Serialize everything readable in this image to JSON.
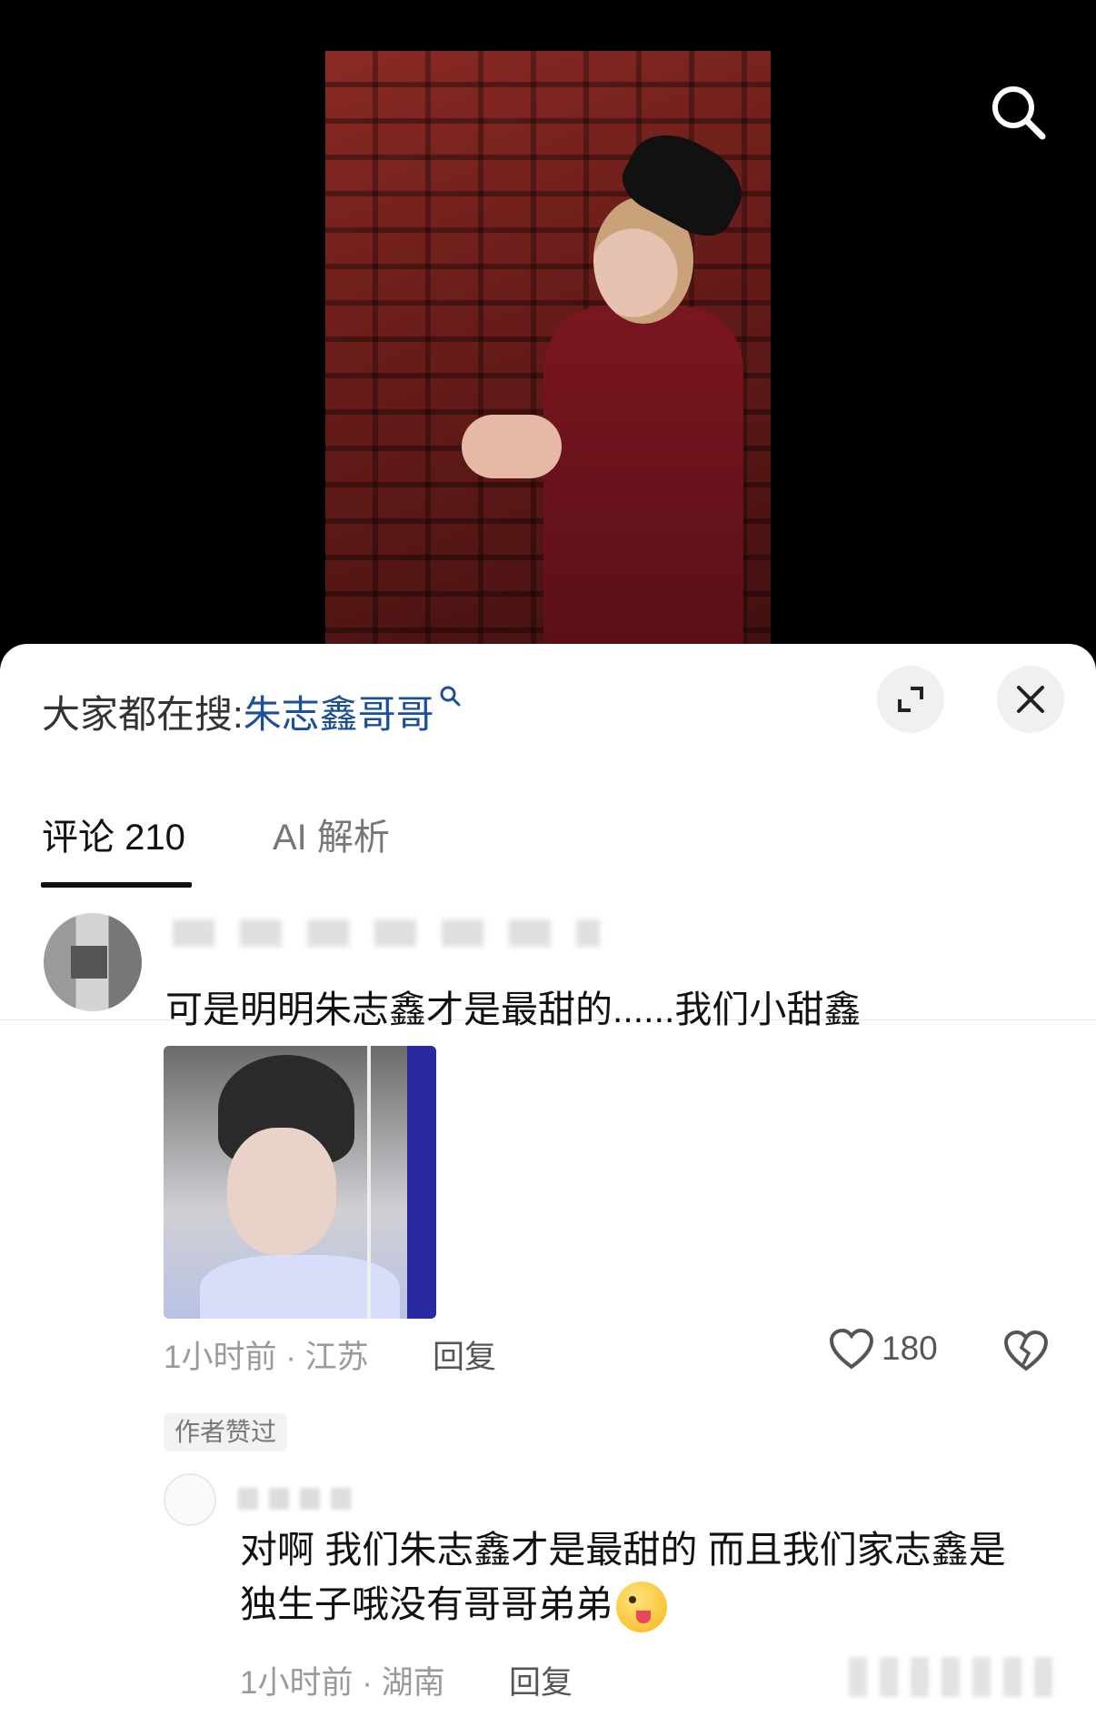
{
  "hot_search": {
    "prefix": "大家都在搜:",
    "query": "朱志鑫哥哥"
  },
  "tabs": [
    {
      "label": "评论 210",
      "active": true
    },
    {
      "label": "AI 解析",
      "active": false
    }
  ],
  "comment": {
    "text": "可是明明朱志鑫才是最甜的......我们小甜鑫",
    "meta": "1小时前 · 江苏",
    "reply_label": "回复",
    "like_count": "180",
    "badge": "作者赞过"
  },
  "reply": {
    "text": "对啊 我们朱志鑫才是最甜的 而且我们家志鑫是独生子哦没有哥哥弟弟",
    "meta": "1小时前 · 湖南",
    "reply_label": "回复"
  },
  "colors": {
    "accent_link": "#1c4e9a",
    "text_primary": "#111111",
    "text_muted": "#9a9a9a"
  },
  "icons": [
    "search-icon",
    "expand-icon",
    "close-icon",
    "heart-icon",
    "broken-heart-icon",
    "small-search-icon"
  ]
}
